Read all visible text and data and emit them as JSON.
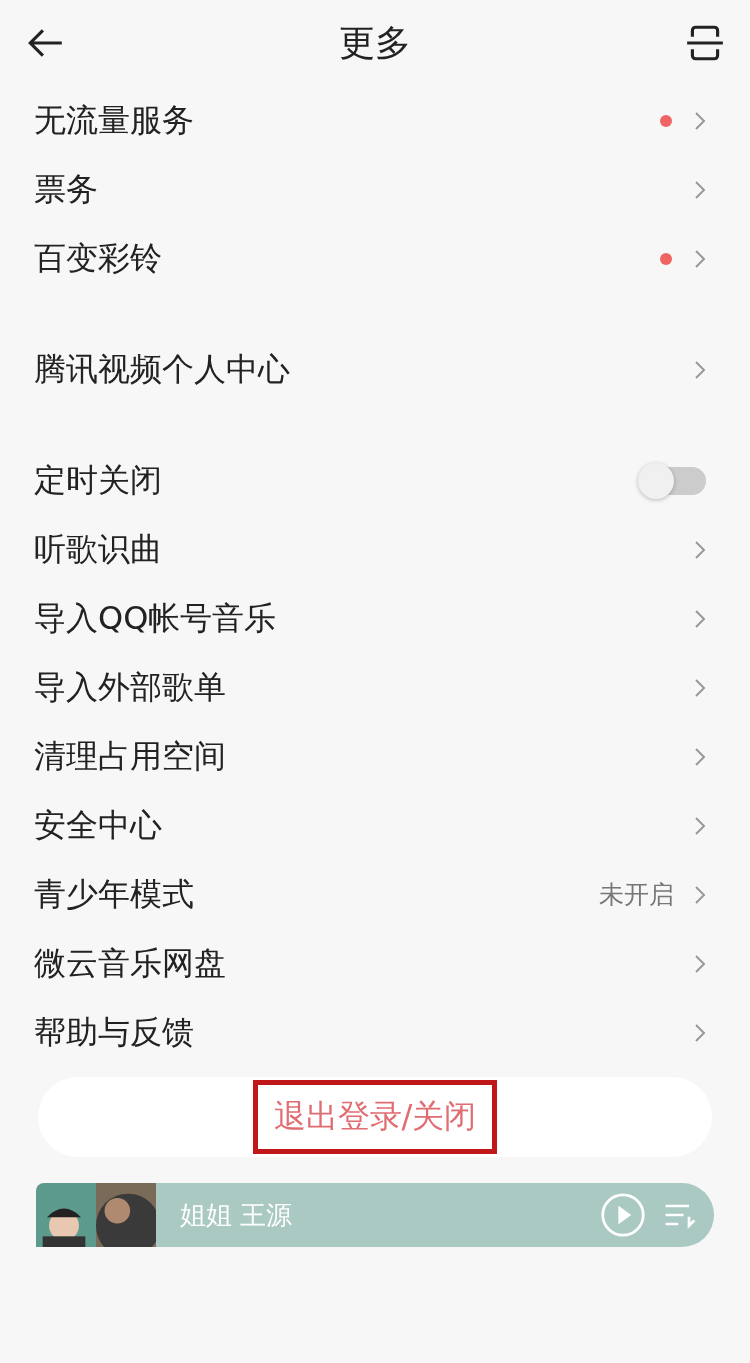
{
  "header": {
    "title": "更多"
  },
  "groups": [
    {
      "items": [
        {
          "kind": "link",
          "label": "无流量服务",
          "dot": true
        },
        {
          "kind": "link",
          "label": "票务",
          "dot": false
        },
        {
          "kind": "link",
          "label": "百变彩铃",
          "dot": true
        }
      ]
    },
    {
      "items": [
        {
          "kind": "link",
          "label": "腾讯视频个人中心",
          "dot": false
        }
      ]
    },
    {
      "items": [
        {
          "kind": "toggle",
          "label": "定时关闭",
          "on": false
        },
        {
          "kind": "link",
          "label": "听歌识曲",
          "dot": false
        },
        {
          "kind": "link",
          "label": "导入QQ帐号音乐",
          "dot": false
        },
        {
          "kind": "link",
          "label": "导入外部歌单",
          "dot": false
        },
        {
          "kind": "link",
          "label": "清理占用空间",
          "dot": false
        },
        {
          "kind": "link",
          "label": "安全中心",
          "dot": false
        },
        {
          "kind": "link",
          "label": "青少年模式",
          "dot": false,
          "value": "未开启"
        },
        {
          "kind": "link",
          "label": "微云音乐网盘",
          "dot": false
        },
        {
          "kind": "link",
          "label": "帮助与反馈",
          "dot": false
        }
      ]
    }
  ],
  "logout": {
    "label": "退出登录/关闭",
    "highlighted": true
  },
  "player": {
    "song": "姐姐  王源"
  }
}
